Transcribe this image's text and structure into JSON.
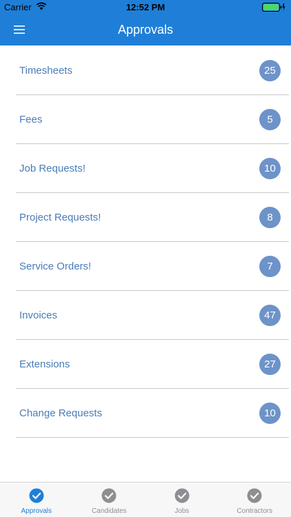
{
  "status_bar": {
    "carrier": "Carrier",
    "time": "12:52 PM"
  },
  "nav": {
    "title": "Approvals",
    "menu_icon": "hamburger-menu-icon"
  },
  "list": [
    {
      "label": "Timesheets",
      "count": "25"
    },
    {
      "label": "Fees",
      "count": "5"
    },
    {
      "label": "Job Requests!",
      "count": "10"
    },
    {
      "label": "Project Requests!",
      "count": "8"
    },
    {
      "label": "Service Orders!",
      "count": "7"
    },
    {
      "label": "Invoices",
      "count": "47"
    },
    {
      "label": "Extensions",
      "count": "27"
    },
    {
      "label": "Change Requests",
      "count": "10"
    }
  ],
  "tabs": [
    {
      "label": "Approvals",
      "icon": "check-circle-icon",
      "active": true
    },
    {
      "label": "Candidates",
      "icon": "check-circle-icon",
      "active": false
    },
    {
      "label": "Jobs",
      "icon": "check-circle-icon",
      "active": false
    },
    {
      "label": "Contractors",
      "icon": "check-circle-icon",
      "active": false
    }
  ],
  "colors": {
    "nav_bar": "#1f7fd8",
    "badge": "#6d93c9",
    "list_text": "#4a7cb8",
    "tab_active": "#1f7fd8",
    "tab_inactive": "#8e8e93",
    "battery": "#4cd964"
  }
}
